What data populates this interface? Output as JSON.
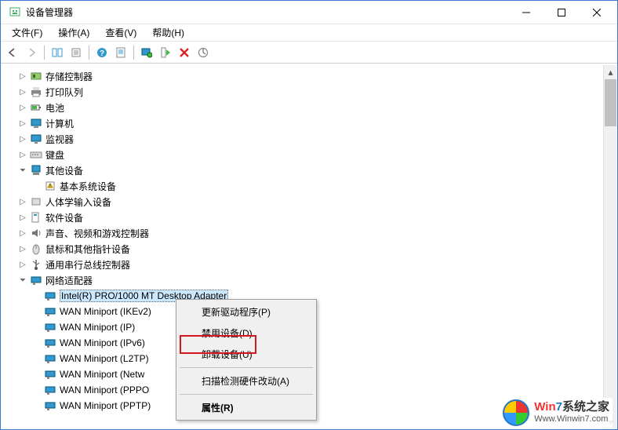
{
  "window": {
    "title": "设备管理器"
  },
  "menubar": {
    "file": "文件(F)",
    "action": "操作(A)",
    "view": "查看(V)",
    "help": "帮助(H)"
  },
  "tree": {
    "storage_controllers": "存储控制器",
    "print_queues": "打印队列",
    "batteries": "电池",
    "computer": "计算机",
    "monitors": "监视器",
    "keyboards": "键盘",
    "other_devices": "其他设备",
    "basic_system_device": "基本系统设备",
    "hid": "人体学输入设备",
    "software_devices": "软件设备",
    "sound_video_game": "声音、视频和游戏控制器",
    "mice_pointing": "鼠标和其他指针设备",
    "usb_controllers": "通用串行总线控制器",
    "network_adapters": "网络适配器",
    "net_intel": "Intel(R) PRO/1000 MT Desktop Adapter",
    "net_wan_ikev2": "WAN Miniport (IKEv2)",
    "net_wan_ip": "WAN Miniport (IP)",
    "net_wan_ipv6": "WAN Miniport (IPv6)",
    "net_wan_l2tp": "WAN Miniport (L2TP)",
    "net_wan_netw": "WAN Miniport (Network Monitor)",
    "net_wan_net_trunc": "WAN Miniport (Netw",
    "net_wan_pppoe": "WAN Miniport (PPPOE)",
    "net_wan_ppp_trunc": "WAN Miniport (PPPO",
    "net_wan_pptp": "WAN Miniport (PPTP)"
  },
  "context_menu": {
    "update_driver": "更新驱动程序(P)",
    "disable_device": "禁用设备(D)",
    "uninstall_device": "卸载设备(U)",
    "scan_hardware": "扫描检测硬件改动(A)",
    "properties": "属性(R)"
  },
  "watermark": {
    "brand_part1": "Win",
    "brand_part2": "7",
    "brand_part3": "系统之家",
    "url": "Www.Winwin7.com"
  }
}
